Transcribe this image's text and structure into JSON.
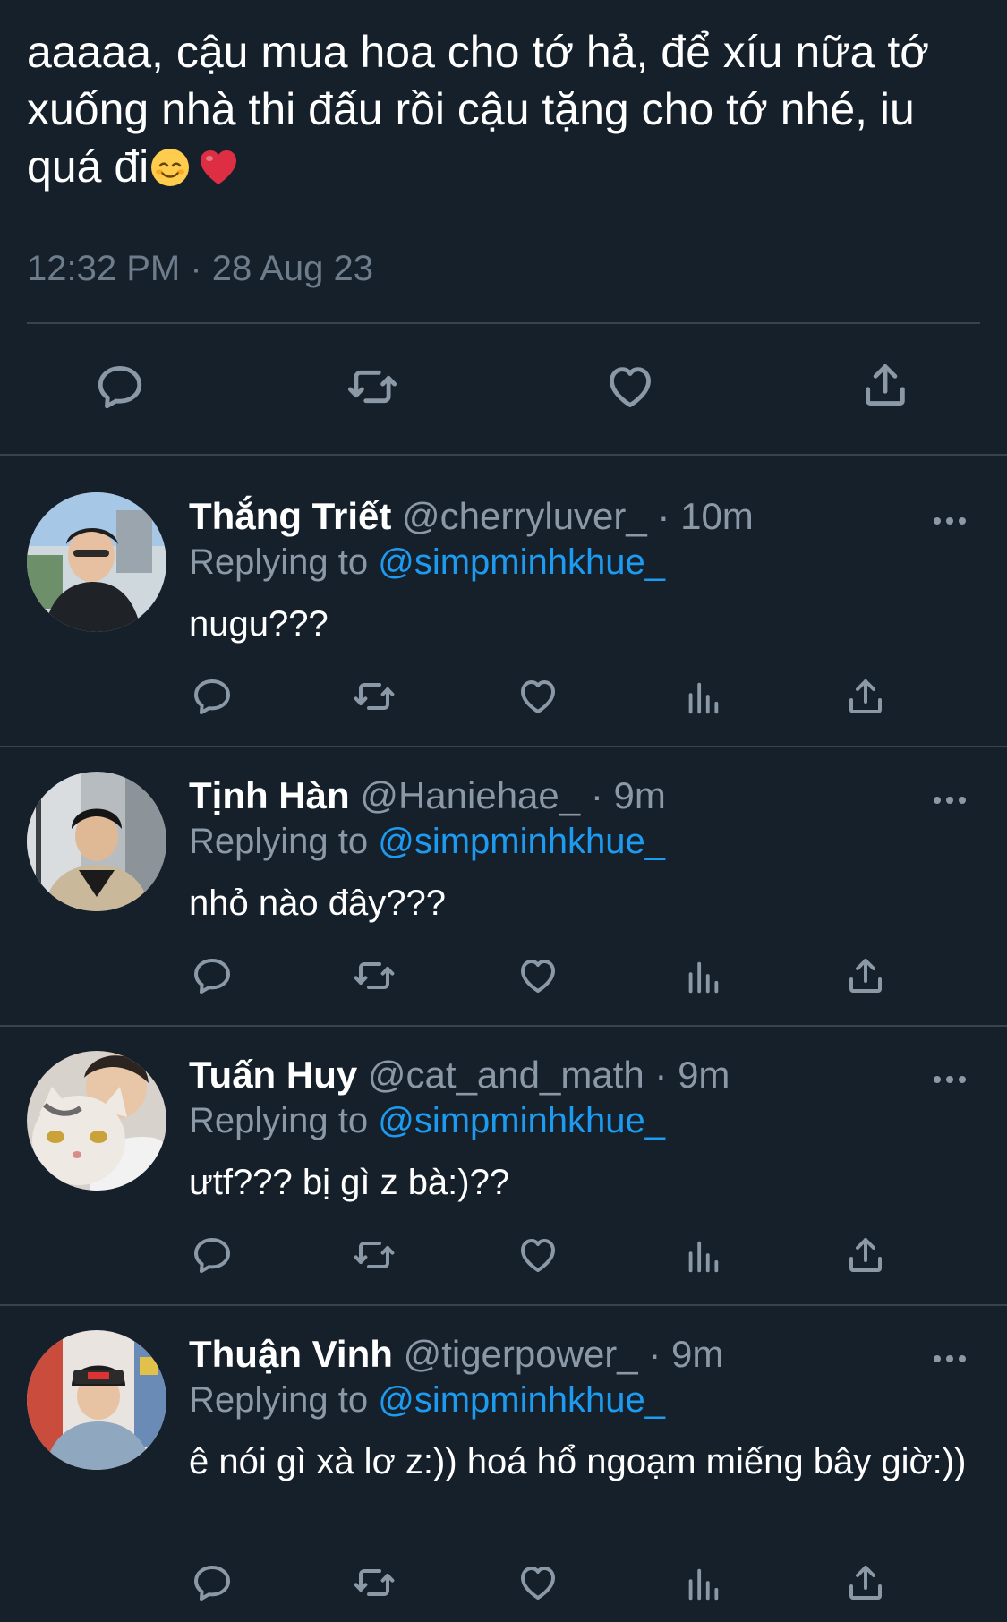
{
  "main_tweet": {
    "text": "aaaaa, cậu mua hoa cho tớ hả, để xíu nữa tớ xuống nhà thi đấu rồi cậu tặng cho tớ nhé, iu quá đi",
    "emojis": [
      "smiling-face-icon",
      "red-heart-icon"
    ],
    "time": "12:32 PM",
    "separator": "·",
    "date": "28 Aug 23",
    "actions": [
      "reply-icon",
      "retweet-icon",
      "like-icon",
      "share-icon"
    ]
  },
  "replies": [
    {
      "display_name": "Thắng Triết",
      "handle": "@cherryluver_",
      "separator": "·",
      "time": "10m",
      "replying_prefix": "Replying to ",
      "replying_handle": "@simpminhkhue_",
      "text": "nugu???"
    },
    {
      "display_name": "Tịnh Hàn",
      "handle": "@Haniehae_",
      "separator": "·",
      "time": "9m",
      "replying_prefix": "Replying to ",
      "replying_handle": "@simpminhkhue_",
      "text": "nhỏ nào đây???"
    },
    {
      "display_name": "Tuấn Huy",
      "handle": "@cat_and_math",
      "separator": "·",
      "time": "9m",
      "replying_prefix": "Replying to ",
      "replying_handle": "@simpminhkhue_",
      "text": "ưtf??? bị gì z bà:)??"
    },
    {
      "display_name": "Thuận Vinh",
      "handle": "@tigerpower_",
      "separator": "·",
      "time": "9m",
      "replying_prefix": "Replying to ",
      "replying_handle": "@simpminhkhue_",
      "text": "ê nói gì xà lơ z:)) hoá hổ ngoạm miếng bây giờ:))"
    }
  ],
  "colors": {
    "background": "#15202b",
    "divider": "#38444d",
    "muted_text": "#8b98a5",
    "link": "#1d9bf0",
    "heart_emoji": "#e0245e"
  }
}
